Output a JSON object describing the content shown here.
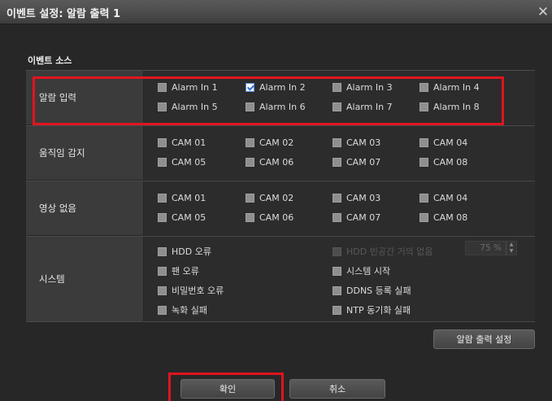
{
  "window": {
    "title": "이벤트 설정: 알람 출력 1",
    "close_symbol": "✕"
  },
  "event_source": {
    "label": "이벤트 소스"
  },
  "alarm_input": {
    "label": "알람 입력",
    "items": [
      {
        "label": "Alarm In 1",
        "checked": false
      },
      {
        "label": "Alarm In 2",
        "checked": true
      },
      {
        "label": "Alarm In 3",
        "checked": false
      },
      {
        "label": "Alarm In 4",
        "checked": false
      },
      {
        "label": "Alarm In 5",
        "checked": false
      },
      {
        "label": "Alarm In 6",
        "checked": false
      },
      {
        "label": "Alarm In 7",
        "checked": false
      },
      {
        "label": "Alarm In 8",
        "checked": false
      }
    ]
  },
  "motion": {
    "label": "움직임 감지",
    "items": [
      "CAM 01",
      "CAM 02",
      "CAM 03",
      "CAM 04",
      "CAM 05",
      "CAM 06",
      "CAM 07",
      "CAM 08"
    ]
  },
  "video_loss": {
    "label": "영상 없음",
    "items": [
      "CAM 01",
      "CAM 02",
      "CAM 03",
      "CAM 04",
      "CAM 05",
      "CAM 06",
      "CAM 07",
      "CAM 08"
    ]
  },
  "system": {
    "label": "시스템",
    "hdd_error": "HDD 오류",
    "hdd_almost_full": "HDD 빈공간 거의 없음",
    "hdd_threshold": "75 %",
    "fan_error": "팬 오류",
    "system_start": "시스템 시작",
    "password_error": "비밀번호 오류",
    "ddns_fail": "DDNS 등록 실패",
    "record_fail": "녹화 실패",
    "ntp_fail": "NTP 동기화 실패"
  },
  "buttons": {
    "alarm_output_settings": "알람 출력 설정",
    "ok": "확인",
    "cancel": "취소"
  }
}
